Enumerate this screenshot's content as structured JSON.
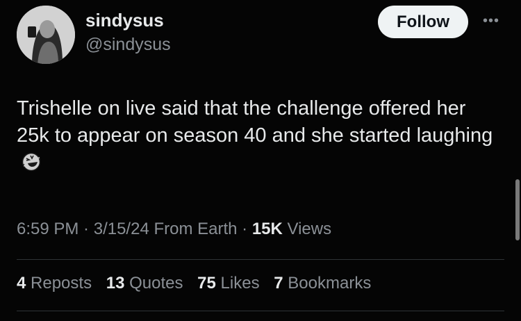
{
  "author": {
    "display_name": "sindysus",
    "handle": "@sindysus"
  },
  "header": {
    "follow_label": "Follow",
    "more_icon": "more-horizontal-icon"
  },
  "tweet": {
    "text": "Trishelle on live said that the challenge offered her 25k to appear on season 40 and she started laughing",
    "emoji": "rolling-on-floor-laughing"
  },
  "meta": {
    "time": "6:59 PM",
    "sep1": " · ",
    "date": "3/15/24",
    "source": " From Earth",
    "sep2": " · ",
    "views_count": "15K",
    "views_label": " Views"
  },
  "stats": {
    "reposts_count": "4",
    "reposts_label": " Reposts",
    "quotes_count": "13",
    "quotes_label": " Quotes",
    "likes_count": "75",
    "likes_label": " Likes",
    "bookmarks_count": "7",
    "bookmarks_label": " Bookmarks"
  }
}
